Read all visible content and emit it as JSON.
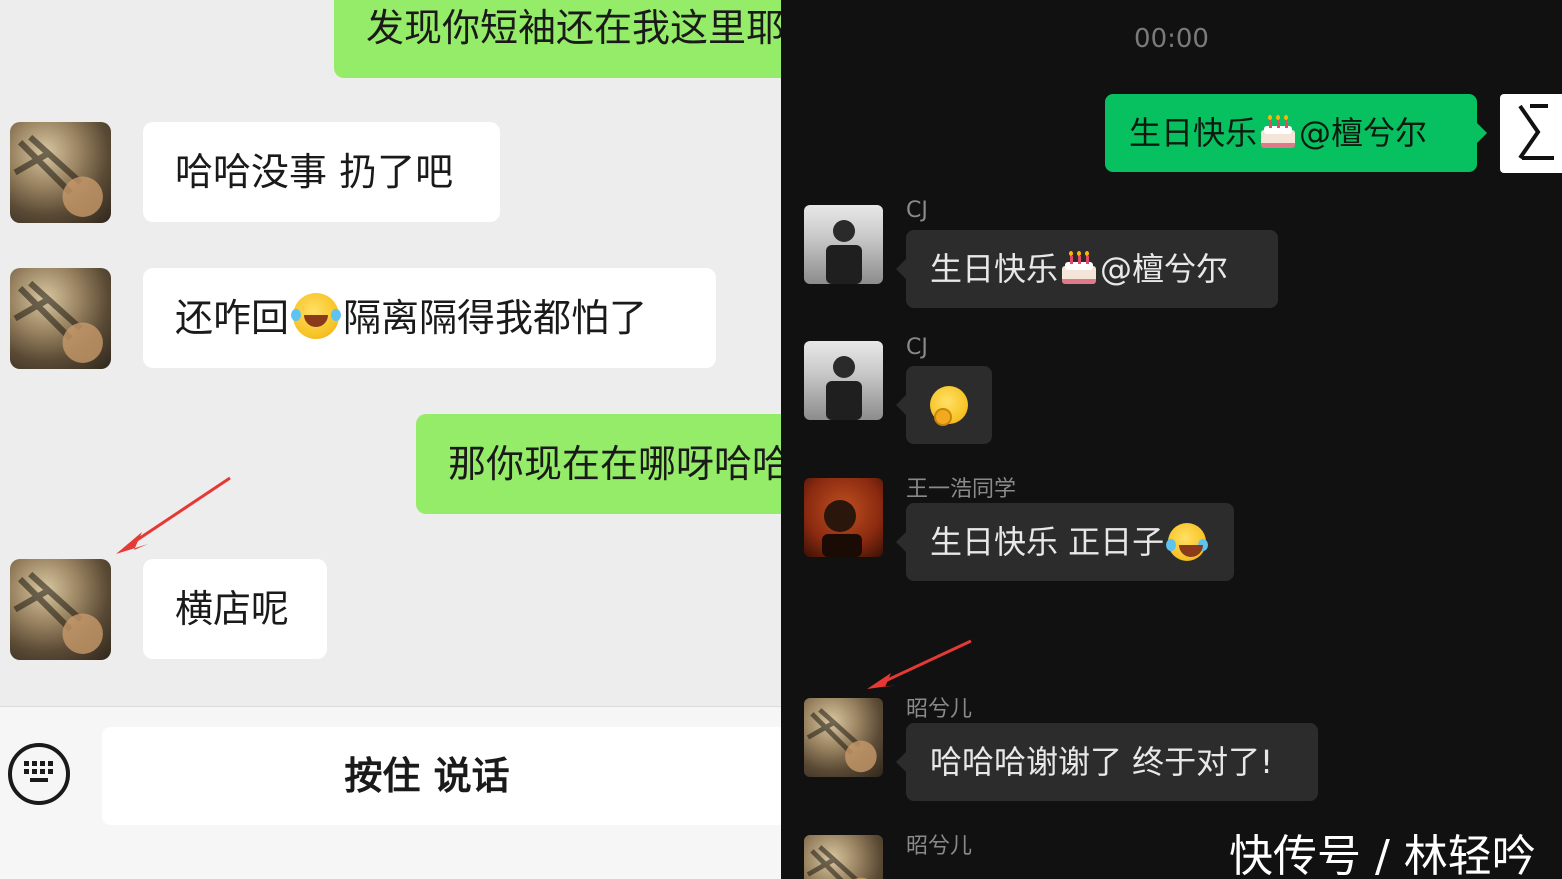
{
  "left_chat": {
    "top_outgoing_text": "发现你短袖还在我这里耶",
    "incoming_1": "哈哈没事 扔了吧",
    "incoming_2_prefix": "还咋回",
    "incoming_2_suffix": "隔离隔得我都怕了",
    "outgoing_2": "那你现在在哪呀哈哈",
    "incoming_3": "横店呢",
    "hold_to_talk_label": "按住 说话"
  },
  "right_chat": {
    "timestamp": "00:00",
    "self_message_text": "生日快乐",
    "self_message_mention": "@檀兮尔",
    "messages": [
      {
        "sender": "CJ",
        "text": "生日快乐",
        "mention": "@檀兮尔"
      },
      {
        "sender": "CJ",
        "text": ""
      },
      {
        "sender": "王一浩同学",
        "text": "生日快乐 正日子"
      },
      {
        "sender": "昭兮儿",
        "text": "哈哈哈谢谢了 终于对了!"
      },
      {
        "sender": "昭兮儿",
        "text": ""
      }
    ]
  },
  "watermark": "快传号 / 林轻吟",
  "icons": [
    "keyboard-icon",
    "laughing-emoji-icon",
    "birthday-cake-emoji-icon",
    "thinking-emoji-icon",
    "annotation-arrow-icon"
  ],
  "colors": {
    "light_bg": "#ededed",
    "outgoing_bubble_light": "#95ec69",
    "dark_bg": "#111111",
    "outgoing_bubble_dark": "#07c160",
    "incoming_bubble_dark": "#2c2c2c",
    "arrow_red": "#e53935"
  }
}
